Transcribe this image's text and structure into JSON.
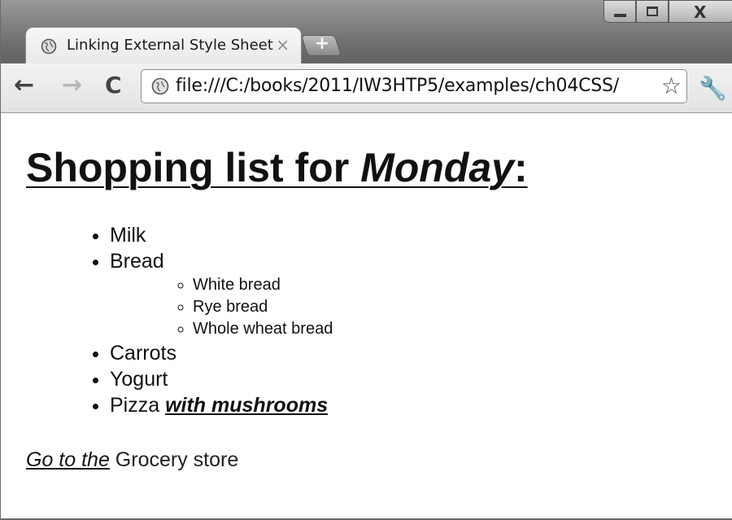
{
  "browser": {
    "tab": {
      "title": "Linking External Style Sheet",
      "close_glyph": "×",
      "icon": "globe-icon"
    },
    "new_tab_glyph": "+",
    "window_controls": {
      "minimize": "minimize-icon",
      "maximize": "maximize-icon",
      "close_glyph": "X"
    },
    "toolbar": {
      "back_glyph": "←",
      "forward_glyph": "→",
      "reload_glyph": "C",
      "address": "file:///C:/books/2011/IW3HTP5/examples/ch04CSS/",
      "bookmark_glyph": "☆",
      "menu_glyph": "🔧"
    }
  },
  "page": {
    "heading": {
      "prefix": "Shopping list for ",
      "day": "Monday",
      "suffix": ":"
    },
    "items": [
      "Milk",
      "Bread",
      "Carrots",
      "Yogurt"
    ],
    "bread_subitems": [
      "White bread",
      "Rye bread",
      "Whole wheat bread"
    ],
    "last_item": {
      "text": "Pizza ",
      "emphasis": "with mushrooms"
    },
    "footer": {
      "link_text": "Go to the",
      "rest": " Grocery store"
    }
  }
}
